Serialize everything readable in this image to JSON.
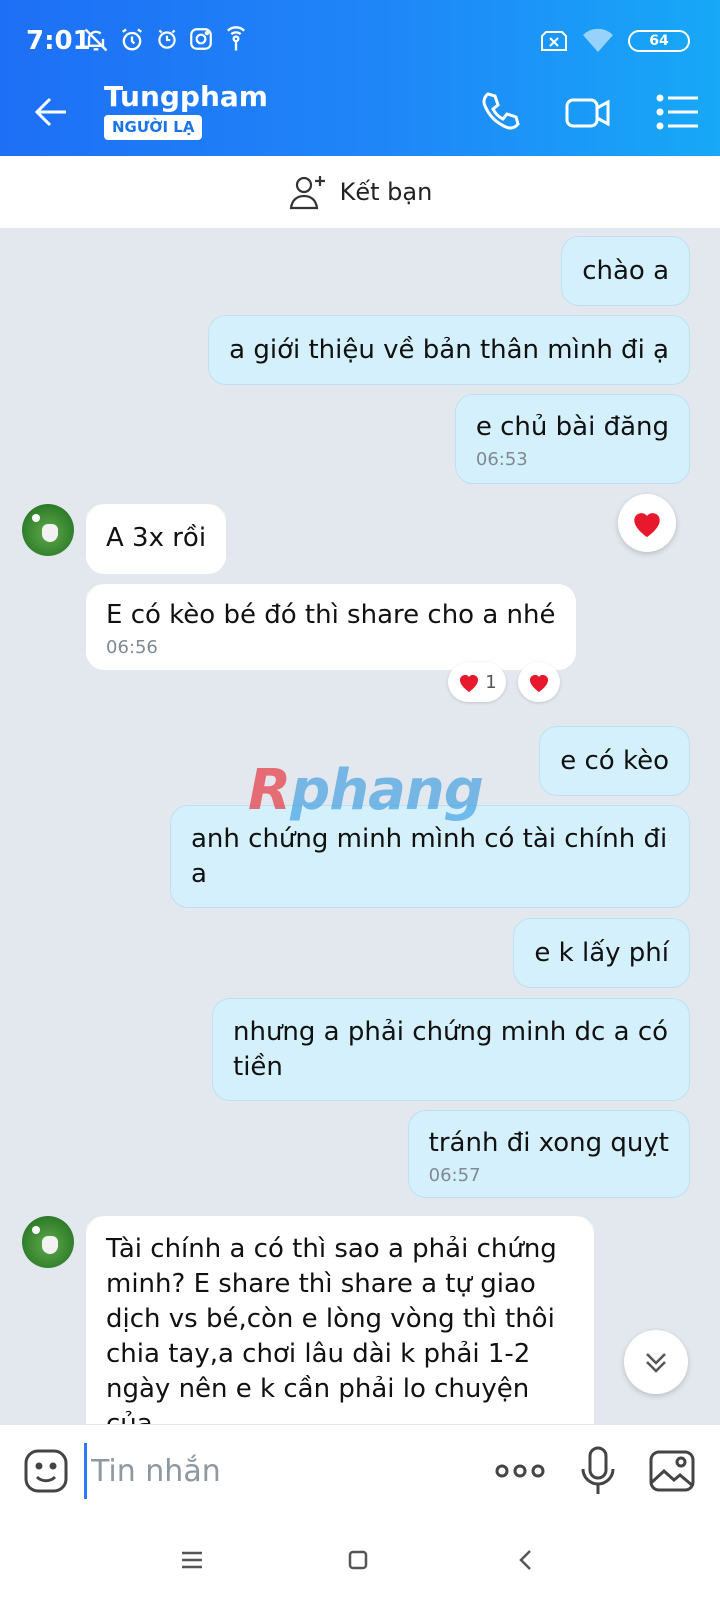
{
  "status": {
    "time": "7:01",
    "battery": "64",
    "icons_left": [
      "mute-bell-icon",
      "alarm-icon",
      "clock-icon",
      "instagram-icon",
      "hotspot-icon"
    ],
    "icons_right": [
      "sim-off-icon",
      "wifi-icon",
      "battery-icon"
    ]
  },
  "header": {
    "name": "Tungpham",
    "badge": "NGƯỜI LẠ",
    "actions": [
      "phone-icon",
      "video-camera-icon",
      "menu-list-icon"
    ]
  },
  "friend_bar": {
    "label": "Kết bạn"
  },
  "messages": [
    {
      "dir": "out",
      "text": "chào a"
    },
    {
      "dir": "out",
      "text": "a giới thiệu về bản thân mình đi ạ"
    },
    {
      "dir": "out",
      "text": "e chủ bài đăng",
      "time": "06:53",
      "reaction": "heart"
    },
    {
      "dir": "in",
      "text": "A 3x rồi"
    },
    {
      "dir": "in",
      "text": "E có kèo bé đó thì share cho a nhé",
      "time": "06:56",
      "reaction_count": "1"
    },
    {
      "dir": "out",
      "text": "e có kèo"
    },
    {
      "dir": "out",
      "text": "anh chứng minh mình có tài chính đi a"
    },
    {
      "dir": "out",
      "text": "e k lấy phí"
    },
    {
      "dir": "out",
      "text": "nhưng a phải chứng minh dc a có tiền"
    },
    {
      "dir": "out",
      "text": "tránh đi xong quỵt",
      "time": "06:57"
    },
    {
      "dir": "in",
      "text": "Tài chính a có thì sao a phải chứng minh? E share thì share a tự giao dịch vs bé,còn e lòng vòng thì thôi chia tay,a chơi lâu dài k phải 1-2 ngày nên e k cần phải lo chuyện của"
    }
  ],
  "watermark": {
    "r": "R",
    "rest": "phang"
  },
  "composer": {
    "placeholder": "Tin nhắn",
    "value": ""
  },
  "colors": {
    "header_start": "#1e6ff5",
    "header_end": "#17a8f7",
    "out_bubble": "#d4f0fc",
    "in_bubble": "#ffffff",
    "heart": "#e8192c"
  }
}
